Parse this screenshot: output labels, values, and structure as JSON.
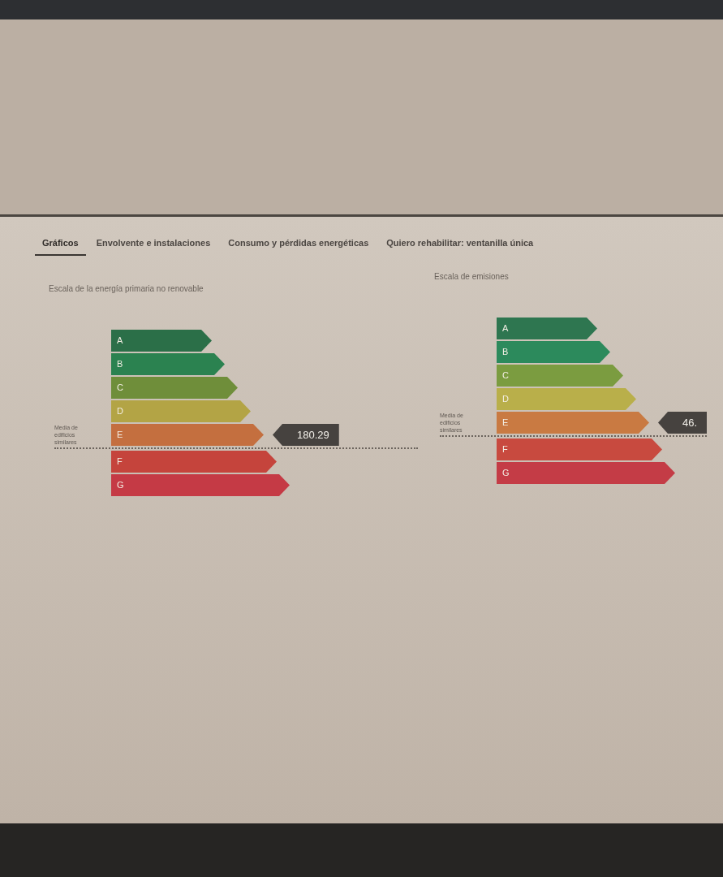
{
  "tabs": [
    {
      "label": "Gráficos",
      "selected": true
    },
    {
      "label": "Envolvente e instalaciones",
      "selected": false
    },
    {
      "label": "Consumo y pérdidas energéticas",
      "selected": false
    },
    {
      "label": "Quiero rehabilitar: ventanilla única",
      "selected": false
    }
  ],
  "charts": [
    {
      "title": "Escala de la energía primaria no renovable",
      "average_label": "Media de edificios similares",
      "rating_value": "180.29",
      "classes": [
        {
          "letter": "A",
          "color": "#2b6f48",
          "selected": false,
          "average": false
        },
        {
          "letter": "B",
          "color": "#2b8250",
          "selected": false,
          "average": false
        },
        {
          "letter": "C",
          "color": "#6f8e3a",
          "selected": false,
          "average": false
        },
        {
          "letter": "D",
          "color": "#b3a445",
          "selected": false,
          "average": false
        },
        {
          "letter": "E",
          "color": "#c46f3f",
          "selected": true,
          "average": true
        },
        {
          "letter": "F",
          "color": "#c5443c",
          "selected": false,
          "average": false
        },
        {
          "letter": "G",
          "color": "#c53a45",
          "selected": false,
          "average": false
        }
      ]
    },
    {
      "title": "Escala de emisiones",
      "average_label": "Media de edificios similares",
      "rating_value": "46.",
      "classes": [
        {
          "letter": "A",
          "color": "#2e7650",
          "selected": false,
          "average": false
        },
        {
          "letter": "B",
          "color": "#2c8a5c",
          "selected": false,
          "average": false
        },
        {
          "letter": "C",
          "color": "#7b9c40",
          "selected": false,
          "average": false
        },
        {
          "letter": "D",
          "color": "#b9af4a",
          "selected": false,
          "average": false
        },
        {
          "letter": "E",
          "color": "#c97a42",
          "selected": true,
          "average": true
        },
        {
          "letter": "F",
          "color": "#c84a3f",
          "selected": false,
          "average": false
        },
        {
          "letter": "G",
          "color": "#c43c46",
          "selected": false,
          "average": false
        }
      ]
    }
  ]
}
